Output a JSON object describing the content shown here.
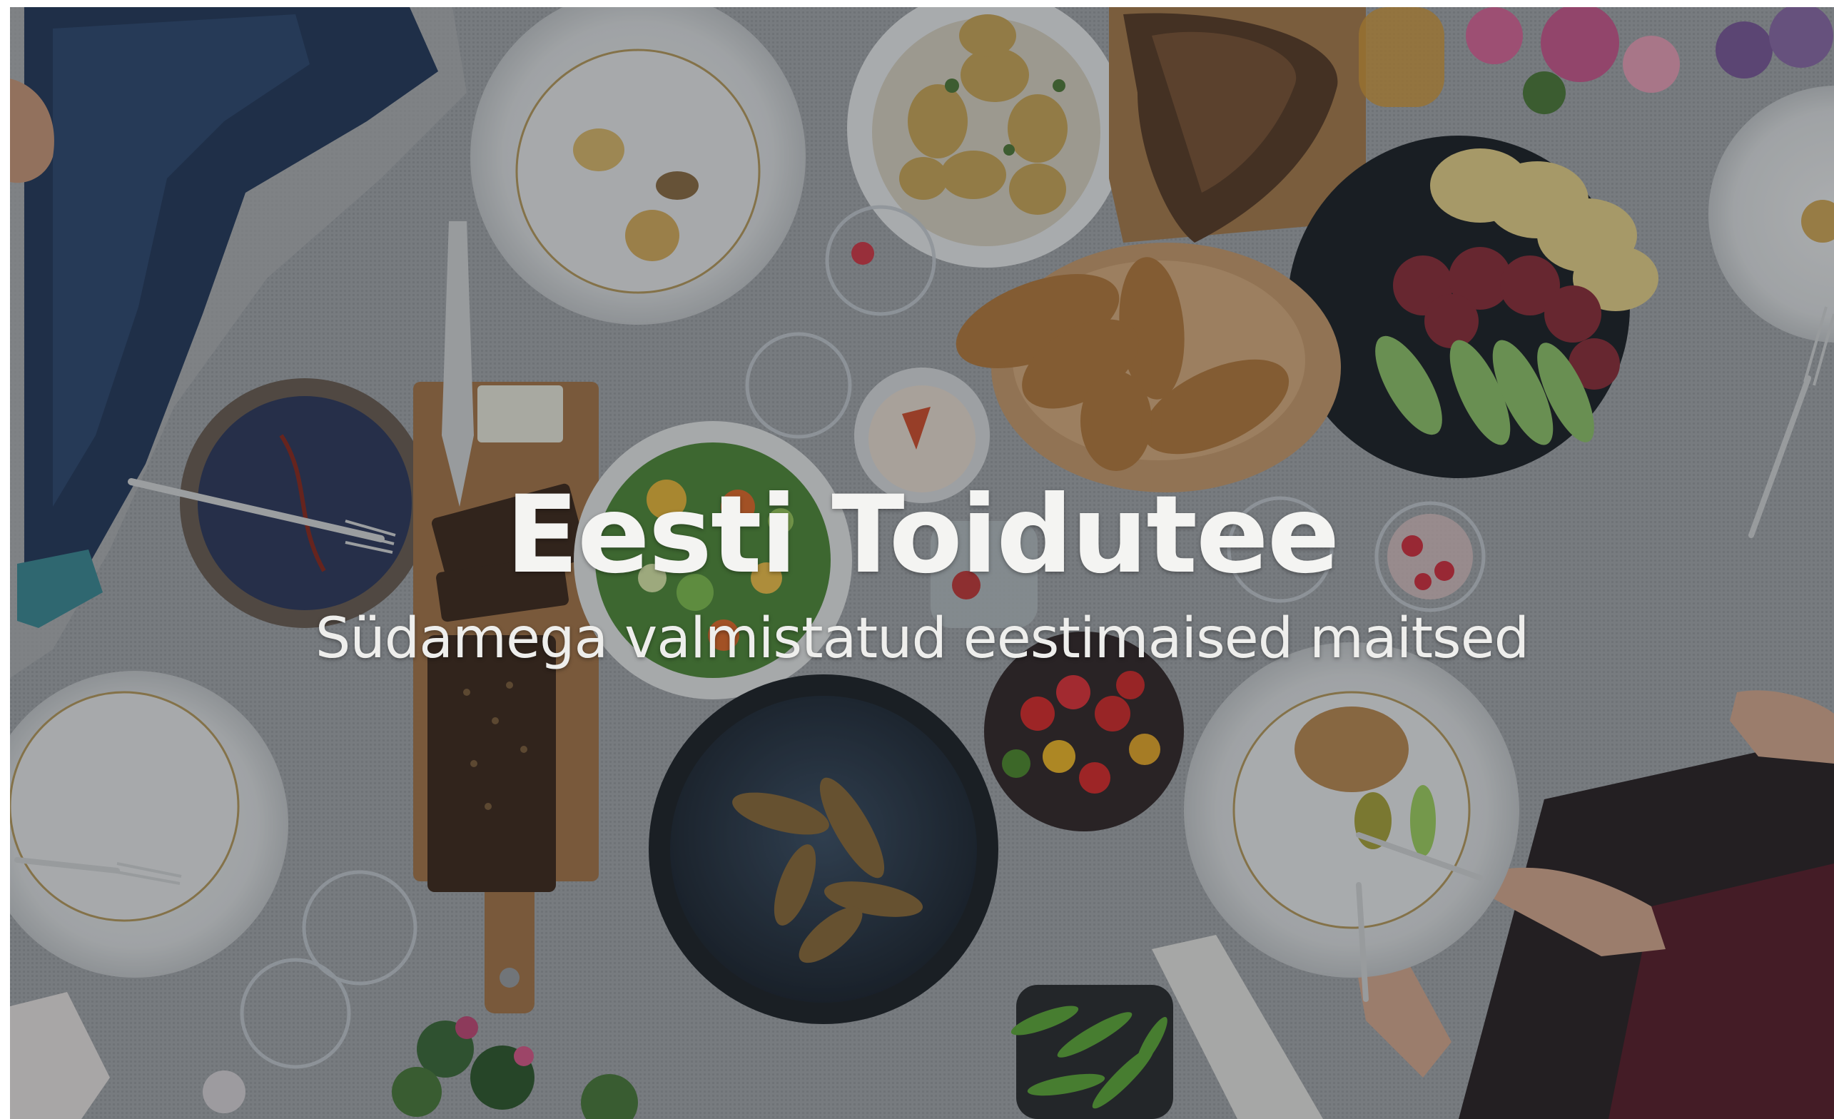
{
  "hero": {
    "title": "Eesti Toidutee",
    "subtitle": "Südamega valmistatud eestimaised maitsed",
    "background_image": "overhead photo of a table set with Estonian dishes: bread, potatoes, smoked fish, sausage, cheese, salad, tomatoes and peas"
  },
  "colors": {
    "title_text": "#f4f4f2",
    "subtitle_text": "#eeeeec",
    "overlay": "#14161a",
    "tablecloth": "#9a9ea3"
  }
}
